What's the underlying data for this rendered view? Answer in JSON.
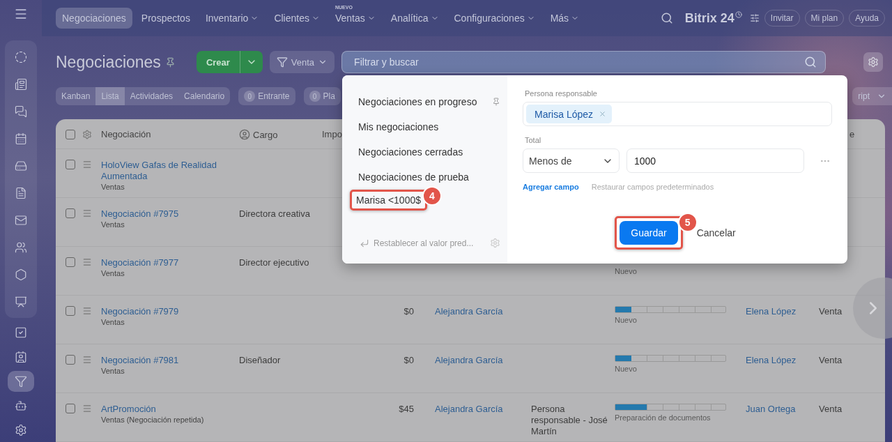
{
  "nav": {
    "items": [
      {
        "label": "Negociaciones",
        "selected": true,
        "dropdown": false
      },
      {
        "label": "Prospectos",
        "selected": false,
        "dropdown": false
      },
      {
        "label": "Inventario",
        "selected": false,
        "dropdown": true
      },
      {
        "label": "Clientes",
        "selected": false,
        "dropdown": true
      },
      {
        "label": "Ventas",
        "selected": false,
        "dropdown": true,
        "tag": "NUEVO"
      },
      {
        "label": "Analítica",
        "selected": false,
        "dropdown": true
      },
      {
        "label": "Configuraciones",
        "selected": false,
        "dropdown": true
      },
      {
        "label": "Más",
        "selected": false,
        "dropdown": true
      }
    ],
    "logo": {
      "name": "Bitrix",
      "suffix": "24"
    },
    "buttons": [
      "Invitar",
      "Mi plan",
      "Ayuda"
    ]
  },
  "sidebar": {
    "items": [
      {
        "kind": "orbit",
        "selected": false,
        "group": true
      },
      {
        "kind": "news",
        "selected": false,
        "group": true
      },
      {
        "kind": "chat",
        "selected": false,
        "group": true
      },
      {
        "kind": "calendar",
        "selected": false,
        "group": true
      },
      {
        "kind": "drive",
        "selected": false,
        "group": true
      },
      {
        "kind": "file",
        "selected": false,
        "group": true
      },
      {
        "kind": "mail",
        "selected": false,
        "group": true
      },
      {
        "kind": "users",
        "selected": false,
        "group": true
      },
      {
        "kind": "hexagon",
        "selected": false,
        "group": true
      },
      {
        "kind": "board",
        "selected": false,
        "group": true
      },
      {
        "kind": "task",
        "selected": false,
        "group": false
      },
      {
        "kind": "contact",
        "selected": false,
        "group": false
      },
      {
        "kind": "funnel",
        "selected": true,
        "group": false
      },
      {
        "kind": "bot",
        "selected": false,
        "group": false
      },
      {
        "kind": "settings",
        "selected": false,
        "group": false
      }
    ]
  },
  "header": {
    "title": "Negociaciones",
    "create": "Crear",
    "pipeline": "Venta",
    "search": {
      "placeholder": "Filtrar y buscar"
    }
  },
  "views": [
    {
      "label": "Kanban",
      "selected": false
    },
    {
      "label": "Lista",
      "selected": true
    },
    {
      "label": "Actividades",
      "selected": false
    },
    {
      "label": "Calendario",
      "selected": false
    }
  ],
  "counters": [
    {
      "count": "0",
      "label": "Entrante"
    },
    {
      "count": "0",
      "label": "Pla"
    }
  ],
  "right_button": "ript",
  "table": {
    "all_checked": false,
    "columns": [
      "Negociación",
      "Cargo",
      "Impo",
      "",
      "",
      "",
      "",
      "e"
    ],
    "rows": [
      {
        "checked": false,
        "title": "HoloView Gafas de Realidad Aumentada",
        "sub": "Ventas"
      },
      {
        "checked": false,
        "title": "Negociación #7975",
        "sub": "Ventas",
        "cargo": "Directora creativa"
      },
      {
        "checked": false,
        "title": "Negociación #7977",
        "sub": "Ventas",
        "cargo": "Director ejecutivo",
        "stage": {
          "label": "Nuevo"
        }
      },
      {
        "checked": false,
        "title": "Negociación #7979",
        "sub": "Ventas",
        "amount": "$0",
        "responsible": "Alejandra García",
        "stage": {
          "level": 0.143,
          "label": "Nuevo"
        },
        "person": "Elena López",
        "type": "Venta"
      },
      {
        "checked": false,
        "title": "Negociación #7981",
        "sub": "Ventas",
        "cargo": "Diseñador",
        "amount": "$0",
        "responsible": "Alejandra García",
        "stage": {
          "level": 0.143,
          "label": "Nuevo"
        },
        "person": "Elena López",
        "type": "Venta"
      },
      {
        "checked": false,
        "title": "ArtPromoción",
        "sub": "Ventas (Negociación repetida)",
        "amount": "$45",
        "responsible": "Alejandra García",
        "note": "Persona responsable - José Martín",
        "stage": {
          "level": 0.286,
          "label": "Preparación de documentos"
        },
        "person": "Juan Ortega",
        "type": "Venta"
      }
    ]
  },
  "filter_popup": {
    "presets": [
      {
        "label": "Negociaciones en progreso",
        "pinned": true
      },
      {
        "label": "Mis negociaciones",
        "pinned": false
      },
      {
        "label": "Negociaciones cerradas",
        "pinned": false
      },
      {
        "label": "Negociaciones de prueba",
        "pinned": false
      },
      {
        "label": "Marisa <1000$",
        "pinned": false,
        "callout": "4"
      }
    ],
    "reset": "Restablecer al valor pred...",
    "fields": [
      {
        "label": "Persona responsable",
        "kind": "tags",
        "tags": [
          "Marisa López"
        ]
      },
      {
        "label": "Total",
        "kind": "range",
        "operator": "Menos de",
        "value": "1000"
      }
    ],
    "add_field": "Agregar campo",
    "restore": "Restaurar campos predeterminados",
    "save": {
      "label": "Guardar",
      "callout": "5"
    },
    "cancel": "Cancelar"
  }
}
